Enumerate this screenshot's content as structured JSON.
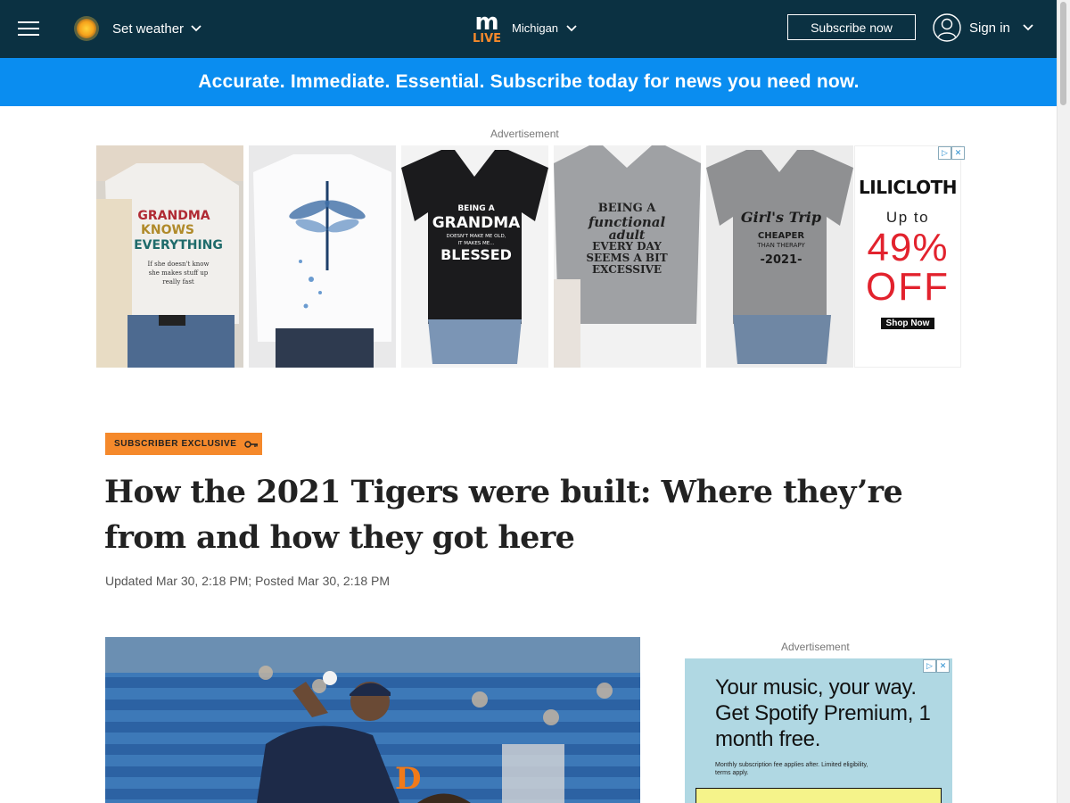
{
  "header": {
    "weather_label": "Set weather",
    "logo_top": "m",
    "logo_bottom": "LIVE",
    "region": "Michigan",
    "subscribe_label": "Subscribe now",
    "signin_label": "Sign in"
  },
  "promo": {
    "text": "Accurate. Immediate. Essential. Subscribe today for news you need now."
  },
  "banner_ad": {
    "label": "Advertisement",
    "brand": "LILICLOTH",
    "offer_prefix": "Up to",
    "offer_percent": "49%",
    "offer_off": "OFF",
    "cta": "Shop Now",
    "shirts": [
      {
        "lines": [
          "GRANDMA",
          "KNOWS",
          "EVERYTHING"
        ],
        "small": [
          "If she doesn't know",
          "she makes stuff up",
          "really fast"
        ]
      },
      {
        "lines": []
      },
      {
        "lines": [
          "BEING A",
          "GRANDMA",
          "DOESN'T MAKE ME OLD,",
          "IT MAKES ME...",
          "BLESSED"
        ]
      },
      {
        "lines": [
          "BEING A",
          "functional",
          "adult",
          "EVERY DAY",
          "SEEMS A BIT",
          "EXCESSIVE"
        ]
      },
      {
        "lines": [
          "Girl's Trip",
          "CHEAPER",
          "THAN THERAPY",
          "-2021-"
        ]
      }
    ]
  },
  "article": {
    "kicker": "SUBSCRIBER EXCLUSIVE",
    "headline": "How the 2021 Tigers were built: Where they’re from and how they got here",
    "dateline": "Updated Mar 30, 2:18 PM; Posted Mar 30, 2:18 PM"
  },
  "side_ad": {
    "label": "Advertisement",
    "headline": "Your music, your way. Get Spotify Premium, 1 month free.",
    "fine_print": "Monthly subscription fee applies after. Limited eligibility, terms apply."
  },
  "colors": {
    "header_bg": "#0b3142",
    "promo_bg": "#0a8df0",
    "kicker_bg": "#f5892b",
    "offer_red": "#e2222d",
    "side_ad_bg": "#b0d8e3"
  },
  "icons": {
    "menu": "hamburger-icon",
    "weather": "sun-icon",
    "user": "user-circle-icon",
    "dropdown": "chevron-down-icon",
    "kicker": "key-icon"
  }
}
